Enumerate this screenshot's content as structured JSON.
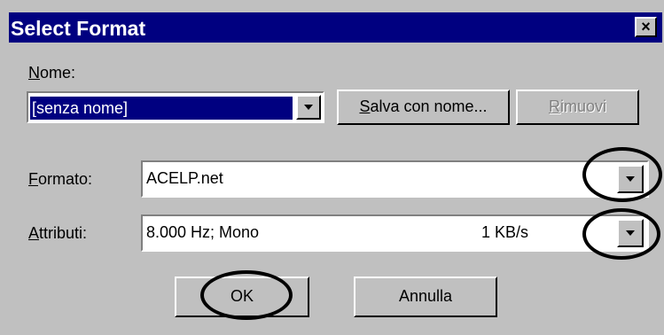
{
  "dialog": {
    "title": "Select Format",
    "close_label": "×"
  },
  "nome": {
    "label_underlined": "N",
    "label_rest": "ome:",
    "value": "[senza nome]"
  },
  "buttons": {
    "save_as_underlined": "S",
    "save_as_rest": "alva con nome...",
    "remove_underlined": "R",
    "remove_rest": "imuovi",
    "ok": "OK",
    "cancel": "Annulla"
  },
  "formato": {
    "label_underlined": "F",
    "label_rest": "ormato:",
    "value": "ACELP.net"
  },
  "attributi": {
    "label_underlined": "A",
    "label_rest": "ttributi:",
    "value": "8.000 Hz; Mono",
    "rate": "1 KB/s"
  },
  "colors": {
    "title_bar": "#000080",
    "face": "#c0c0c0",
    "selection": "#000080"
  },
  "icons": [
    "close-icon",
    "dropdown-arrow-icon"
  ]
}
